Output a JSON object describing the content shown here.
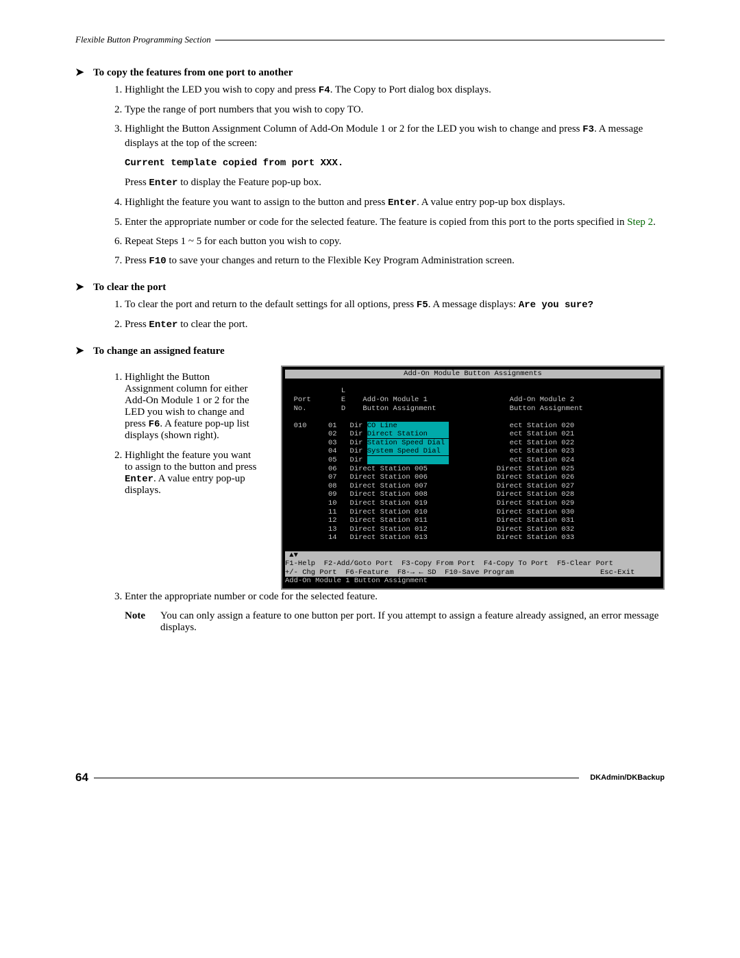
{
  "header": "Flexible Button Programming Section",
  "sec1": {
    "title": "To copy the features from one port to another",
    "items": {
      "i1a": "Highlight the LED you wish to copy and press ",
      "i1k": "F4",
      "i1b": ". The Copy to Port dialog box displays.",
      "i2": "Type the range of port numbers that you wish to copy TO.",
      "i3a": "Highlight the Button Assignment Column of Add-On Module 1 or 2 for the LED you wish to change and press ",
      "i3k": "F3",
      "i3b": ". A message displays at the top of the screen:",
      "i3code": "Current template copied from port XXX.",
      "i3c": "Press ",
      "i3k2": "Enter",
      "i3d": " to display the Feature pop-up box.",
      "i4a": "Highlight the feature you want to assign to the button and press ",
      "i4k": "Enter",
      "i4b": ". A value entry pop-up box displays.",
      "i5a": "Enter the appropriate number or code for the selected feature. The feature is copied from this port to the ports specified in ",
      "i5link": "Step 2",
      "i5b": ".",
      "i6": "Repeat Steps 1 ~ 5 for each button you wish to copy.",
      "i7a": "Press ",
      "i7k": "F10",
      "i7b": " to save your changes and return to the Flexible Key Program Administration screen."
    }
  },
  "sec2": {
    "title": "To clear the port",
    "items": {
      "i1a": "To clear the port and return to the default settings for all options, press ",
      "i1k": "F5",
      "i1b": ". A message displays: ",
      "i1code": "Are you sure?",
      "i2a": "Press ",
      "i2k": "Enter",
      "i2b": " to clear the port."
    }
  },
  "sec3": {
    "title": "To change an assigned feature",
    "items": {
      "i1a": "Highlight the Button Assignment column for either Add-On Module 1 or 2 for the LED you wish to change and press ",
      "i1k": "F6",
      "i1b": ". A feature pop-up list displays (shown right).",
      "i2a": "Highlight the feature you want to assign to the button and press ",
      "i2k": "Enter",
      "i2b": ". A value entry pop-up displays.",
      "i3": "Enter the appropriate number or code for the selected feature."
    }
  },
  "note": {
    "label": "Note",
    "text": "You can only assign a feature to one button per port. If you attempt to assign a feature already assigned, an error message displays."
  },
  "terminal": {
    "title": "Add-On Module Button Assignments",
    "headers": "             L\n  Port       E    Add-On Module 1                   Add-On Module 2\n  No.        D    Button Assignment                 Button Assignment",
    "port": "  010",
    "leds": [
      "01",
      "02",
      "03",
      "04",
      "05",
      "06",
      "07",
      "08",
      "09",
      "10",
      "11",
      "12",
      "13",
      "14"
    ],
    "dir": "Dir",
    "popup": [
      "CO Line            ",
      "Direct Station     ",
      "Station Speed Dial ",
      "System Speed Dial  ",
      "                   "
    ],
    "col1tail": [
      "ect Station 005",
      "Direct Station 006",
      "Direct Station 007",
      "Direct Station 008",
      "Direct Station 019",
      "Direct Station 010",
      "Direct Station 011",
      "Direct Station 012",
      "Direct Station 013"
    ],
    "col2part": [
      "ect Station 020",
      "ect Station 021",
      "ect Station 022",
      "ect Station 023",
      "ect Station 024"
    ],
    "col2full": [
      "Direct Station 025",
      "Direct Station 026",
      "Direct Station 027",
      "Direct Station 028",
      "Direct Station 029",
      "Direct Station 030",
      "Direct Station 031",
      "Direct Station 032",
      "Direct Station 033"
    ],
    "scrollmark": "▲▼",
    "bar1": "F1-Help  F2-Add/Goto Port  F3-Copy From Port  F4-Copy To Port  F5-Clear Port",
    "bar2": "+/- Chg Port  F6-Feature  F8-→ ← SD  F10-Save Program                    Esc-Exit",
    "status": "Add-On Module 1 Button Assignment"
  },
  "footer": {
    "page": "64",
    "right": "DKAdmin/DKBackup"
  }
}
